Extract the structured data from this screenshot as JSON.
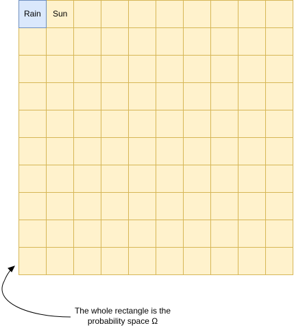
{
  "grid": {
    "rows": 10,
    "cols": 10,
    "fill_color": "#fff2cc",
    "line_color": "#d6b656",
    "highlight_fill": "#dae8fc",
    "highlight_line": "#6c8ebf"
  },
  "cells": {
    "rain_label": "Rain",
    "sun_label": "Sun"
  },
  "annotation": {
    "line1": "The whole rectangle is the",
    "line2": "probability space Ω",
    "arrow_color": "#000000"
  }
}
